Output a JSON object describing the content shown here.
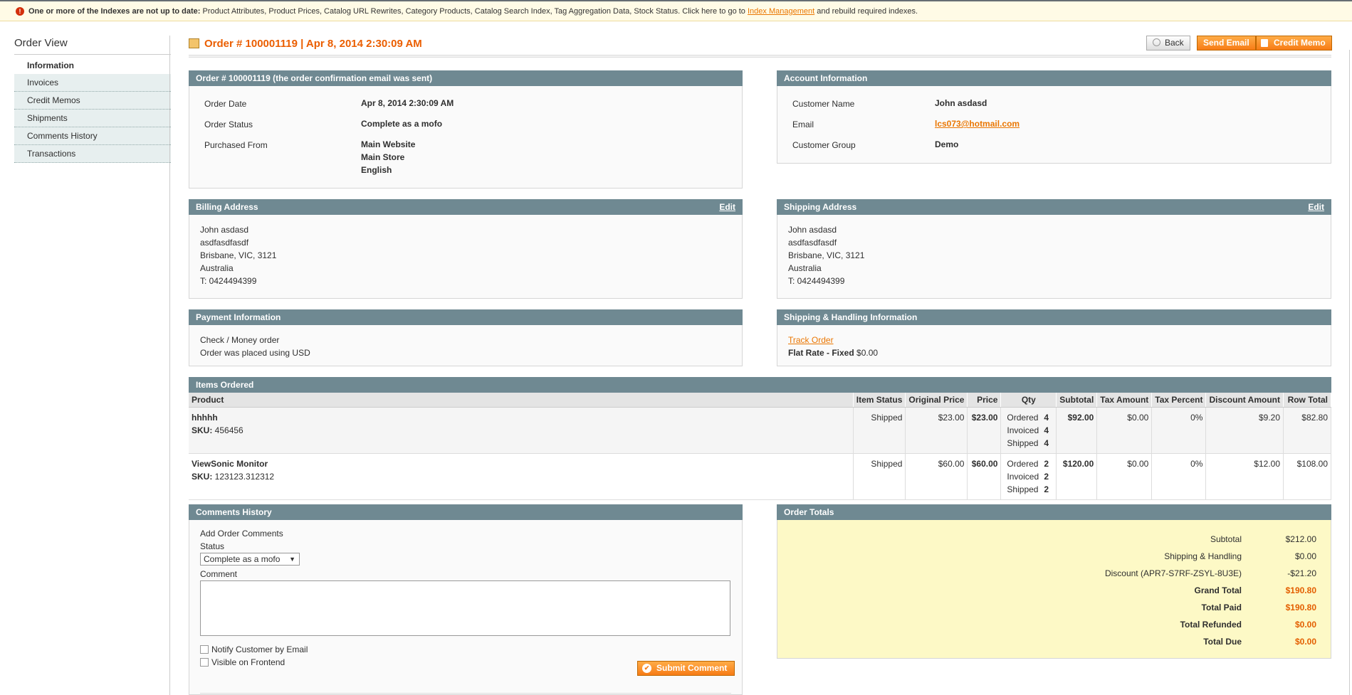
{
  "notice": {
    "lead": "One or more of the Indexes are not up to date:",
    "text": " Product Attributes, Product Prices, Catalog URL Rewrites, Category Products, Catalog Search Index, Tag Aggregation Data, Stock Status. Click here to go to ",
    "link": "Index Management",
    "tail": " and rebuild required indexes."
  },
  "sidebar": {
    "title": "Order View",
    "items": [
      "Information",
      "Invoices",
      "Credit Memos",
      "Shipments",
      "Comments History",
      "Transactions"
    ]
  },
  "header": {
    "title": "Order # 100001119 | Apr 8, 2014 2:30:09 AM",
    "back": "Back",
    "send_email": "Send Email",
    "credit_memo": "Credit Memo"
  },
  "order": {
    "title": "Order # 100001119 (the order confirmation email was sent)",
    "date_label": "Order Date",
    "date": "Apr 8, 2014 2:30:09 AM",
    "status_label": "Order Status",
    "status": "Complete as a mofo",
    "from_label": "Purchased From",
    "from1": "Main Website",
    "from2": "Main Store",
    "from3": "English"
  },
  "account": {
    "title": "Account Information",
    "name_label": "Customer Name",
    "name": "John asdasd",
    "email_label": "Email",
    "email": "lcs073@hotmail.com",
    "group_label": "Customer Group",
    "group": "Demo"
  },
  "billing": {
    "title": "Billing Address",
    "edit": "Edit",
    "l1": "John asdasd",
    "l2": "asdfasdfasdf",
    "l3": "Brisbane, VIC, 3121",
    "l4": "Australia",
    "l5": "T: 0424494399"
  },
  "shipping": {
    "title": "Shipping Address",
    "edit": "Edit",
    "l1": "John asdasd",
    "l2": "asdfasdfasdf",
    "l3": "Brisbane, VIC, 3121",
    "l4": "Australia",
    "l5": "T: 0424494399"
  },
  "payment": {
    "title": "Payment Information",
    "l1": "Check / Money order",
    "l2": "Order was placed using USD"
  },
  "handling": {
    "title": "Shipping & Handling Information",
    "track": "Track Order",
    "method": "Flat Rate - Fixed",
    "price": " $0.00"
  },
  "items": {
    "title": "Items Ordered",
    "headers": [
      "Product",
      "Item Status",
      "Original Price",
      "Price",
      "Qty",
      "Subtotal",
      "Tax Amount",
      "Tax Percent",
      "Discount Amount",
      "Row Total"
    ],
    "sku_label": "SKU:",
    "qty_ordered": "Ordered",
    "qty_invoiced": "Invoiced",
    "qty_shipped": "Shipped",
    "rows": [
      {
        "name": "hhhhh",
        "sku": " 456456",
        "status": "Shipped",
        "orig": "$23.00",
        "price": "$23.00",
        "ordered": "4",
        "invoiced": "4",
        "shipped": "4",
        "subtotal": "$92.00",
        "tax": "$0.00",
        "taxp": "0%",
        "disc": "$9.20",
        "total": "$82.80"
      },
      {
        "name": "ViewSonic Monitor",
        "sku": " 123123.312312",
        "status": "Shipped",
        "orig": "$60.00",
        "price": "$60.00",
        "ordered": "2",
        "invoiced": "2",
        "shipped": "2",
        "subtotal": "$120.00",
        "tax": "$0.00",
        "taxp": "0%",
        "disc": "$12.00",
        "total": "$108.00"
      }
    ]
  },
  "comments": {
    "title": "Comments History",
    "add": "Add Order Comments",
    "status_label": "Status",
    "status_value": "Complete as a mofo",
    "comment_label": "Comment",
    "notify": "Notify Customer by Email",
    "visible": "Visible on Frontend",
    "submit": "Submit Comment"
  },
  "totals": {
    "title": "Order Totals",
    "subtotal_label": "Subtotal",
    "subtotal": "$212.00",
    "shipping_label": "Shipping & Handling",
    "shipping": "$0.00",
    "discount_label": "Discount (APR7-S7RF-ZSYL-8U3E)",
    "discount": "-$21.20",
    "grand_label": "Grand Total",
    "grand": "$190.80",
    "paid_label": "Total Paid",
    "paid": "$190.80",
    "refunded_label": "Total Refunded",
    "refunded": "$0.00",
    "due_label": "Total Due",
    "due": "$0.00"
  }
}
